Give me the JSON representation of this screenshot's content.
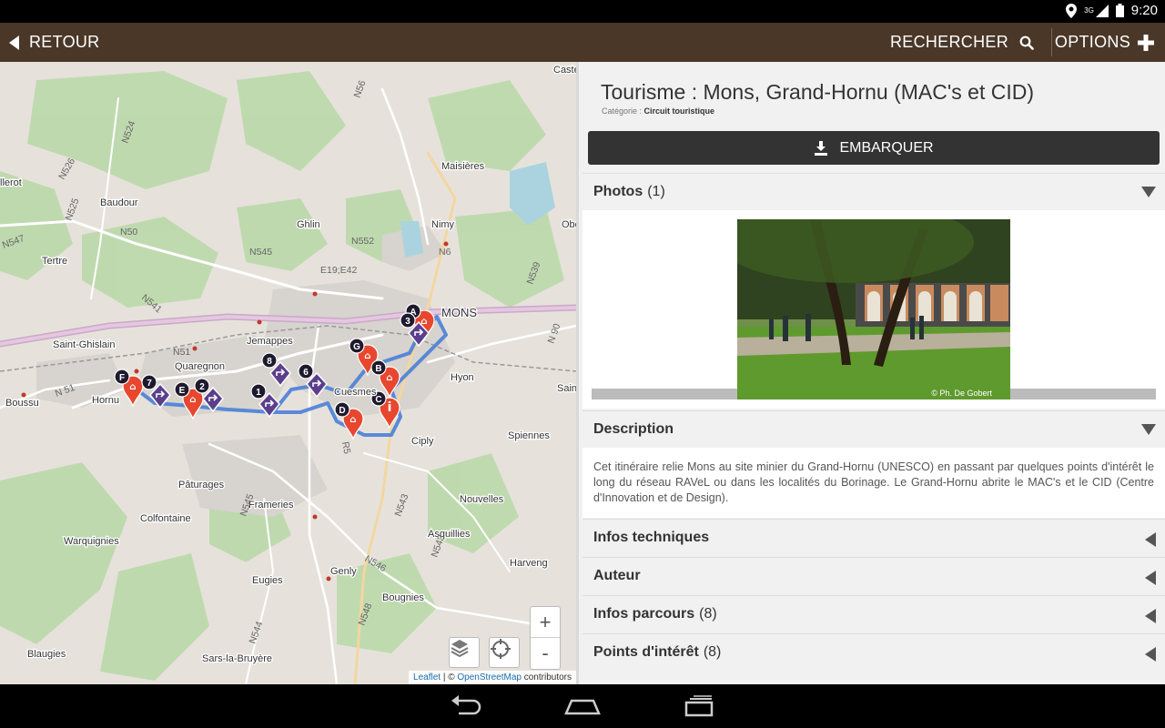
{
  "status_bar": {
    "time": "9:20",
    "network": "3G"
  },
  "app_bar": {
    "back_label": "RETOUR",
    "search_label": "RECHERCHER",
    "options_label": "OPTIONS"
  },
  "map": {
    "attribution_leaflet": "Leaflet",
    "attribution_sep": " | © ",
    "attribution_osm": "OpenStreetMap",
    "attribution_tail": " contributors",
    "zoom_in": "+",
    "zoom_out": "-",
    "places": [
      {
        "name": "Maisières"
      },
      {
        "name": "Baudour"
      },
      {
        "name": "Ghlin"
      },
      {
        "name": "Nimy"
      },
      {
        "name": "Tertre"
      },
      {
        "name": "Saint-Ghislain"
      },
      {
        "name": "Quaregnon"
      },
      {
        "name": "Jemappes"
      },
      {
        "name": "Cuesmes"
      },
      {
        "name": "Hyon"
      },
      {
        "name": "Boussu"
      },
      {
        "name": "Hornu"
      },
      {
        "name": "Ciply"
      },
      {
        "name": "Spiennes"
      },
      {
        "name": "Pâturages"
      },
      {
        "name": "Frameries"
      },
      {
        "name": "Colfontaine"
      },
      {
        "name": "Nouvelles"
      },
      {
        "name": "Warquignies"
      },
      {
        "name": "Asquillies"
      },
      {
        "name": "Harveng"
      },
      {
        "name": "Eugies"
      },
      {
        "name": "Genly"
      },
      {
        "name": "Bougnies"
      },
      {
        "name": "Blaugies"
      },
      {
        "name": "Sars-la-Bruyère"
      },
      {
        "name": "Obourg"
      },
      {
        "name": "Castea"
      },
      {
        "name": "Sain"
      },
      {
        "name": "llerot"
      },
      {
        "name": "MONS"
      }
    ],
    "roads": [
      {
        "label": "N524"
      },
      {
        "label": "N526"
      },
      {
        "label": "N525"
      },
      {
        "label": "N50"
      },
      {
        "label": "N545"
      },
      {
        "label": "N552"
      },
      {
        "label": "N56"
      },
      {
        "label": "N6"
      },
      {
        "label": "N539"
      },
      {
        "label": "N541"
      },
      {
        "label": "E19;E42"
      },
      {
        "label": "N51"
      },
      {
        "label": "N 51"
      },
      {
        "label": "N 90"
      },
      {
        "label": "N543"
      },
      {
        "label": "N546"
      },
      {
        "label": "N545"
      },
      {
        "label": "N544"
      },
      {
        "label": "N548"
      },
      {
        "label": "N547"
      },
      {
        "label": "R5"
      },
      {
        "label": "N543"
      }
    ],
    "markers": [
      {
        "label": "F",
        "kind": "poi"
      },
      {
        "label": "7",
        "kind": "step"
      },
      {
        "label": "E",
        "kind": "poi"
      },
      {
        "label": "2",
        "kind": "step"
      },
      {
        "label": "1",
        "kind": "step"
      },
      {
        "label": "8",
        "kind": "step"
      },
      {
        "label": "6",
        "kind": "step"
      },
      {
        "label": "G",
        "kind": "poi"
      },
      {
        "label": "B",
        "kind": "poi"
      },
      {
        "label": "C",
        "kind": "info"
      },
      {
        "label": "D",
        "kind": "poi"
      },
      {
        "label": "A",
        "kind": "poi"
      },
      {
        "label": "3",
        "kind": "step"
      }
    ]
  },
  "detail": {
    "title": "Tourisme : Mons, Grand-Hornu (MAC's et CID)",
    "category_label": "Catégorie : ",
    "category_value": "Circuit touristique",
    "embark_label": "EMBARQUER",
    "photos": {
      "label": "Photos",
      "count": "(1)",
      "credit": "© Ph. De Gobert"
    },
    "description": {
      "label": "Description",
      "text": "Cet itinéraire relie Mons au site minier du Grand-Hornu (UNESCO) en passant par quelques points d'intérêt le long du réseau RAVeL ou dans les localités du Borinage. Le Grand-Hornu abrite le MAC's et le CID (Centre d'Innovation et de Design)."
    },
    "sections": [
      {
        "label": "Infos techniques",
        "count": ""
      },
      {
        "label": "Auteur",
        "count": ""
      },
      {
        "label": "Infos parcours",
        "count": "(8)"
      },
      {
        "label": "Points d'intérêt",
        "count": "(8)"
      }
    ]
  },
  "colors": {
    "app_bar": "#4a3728",
    "route": "#4a7fd6",
    "poi_marker": "#e8472f",
    "step_marker": "#5b3f8c",
    "embark_button": "#333333"
  }
}
